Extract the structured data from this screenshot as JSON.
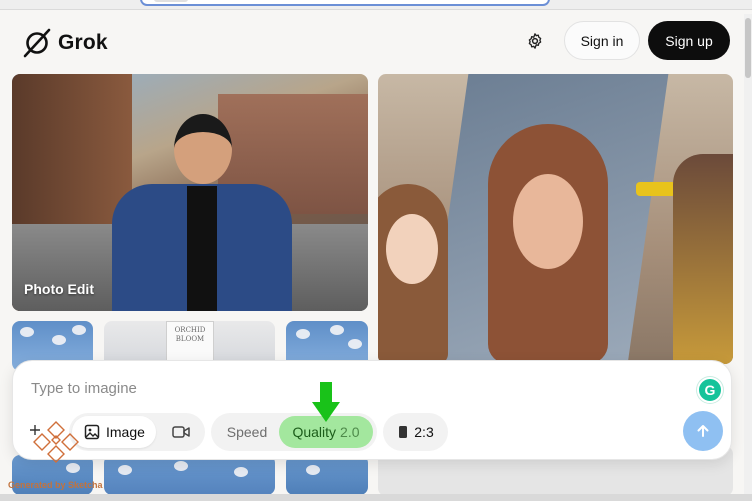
{
  "header": {
    "logo_text": "Grok",
    "signin_label": "Sign in",
    "signup_label": "Sign up"
  },
  "gallery": {
    "tiles": [
      {
        "label": "Photo Edit"
      }
    ],
    "product_label": "ORCHID BLOOM"
  },
  "composer": {
    "placeholder": "Type to imagine",
    "mode_image_label": "Image",
    "speed_label": "Speed",
    "quality_label": "Quality",
    "quality_version": "2.0",
    "aspect_ratio": "2:3"
  },
  "watermark": {
    "text": "Generated by Sketcha"
  },
  "colors": {
    "quality_active_bg": "#a3e79e",
    "signup_bg": "#0d0d0d",
    "send_bg": "#8fc0f2",
    "arrow": "#19c219"
  },
  "icons": {
    "logo": "grok-logo-icon",
    "settings": "gear-icon",
    "image_mode": "image-icon",
    "video_mode": "video-camera-icon",
    "aspect_ratio": "portrait-rectangle-icon",
    "send": "arrow-up-icon",
    "grammarly": "grammarly-icon"
  }
}
